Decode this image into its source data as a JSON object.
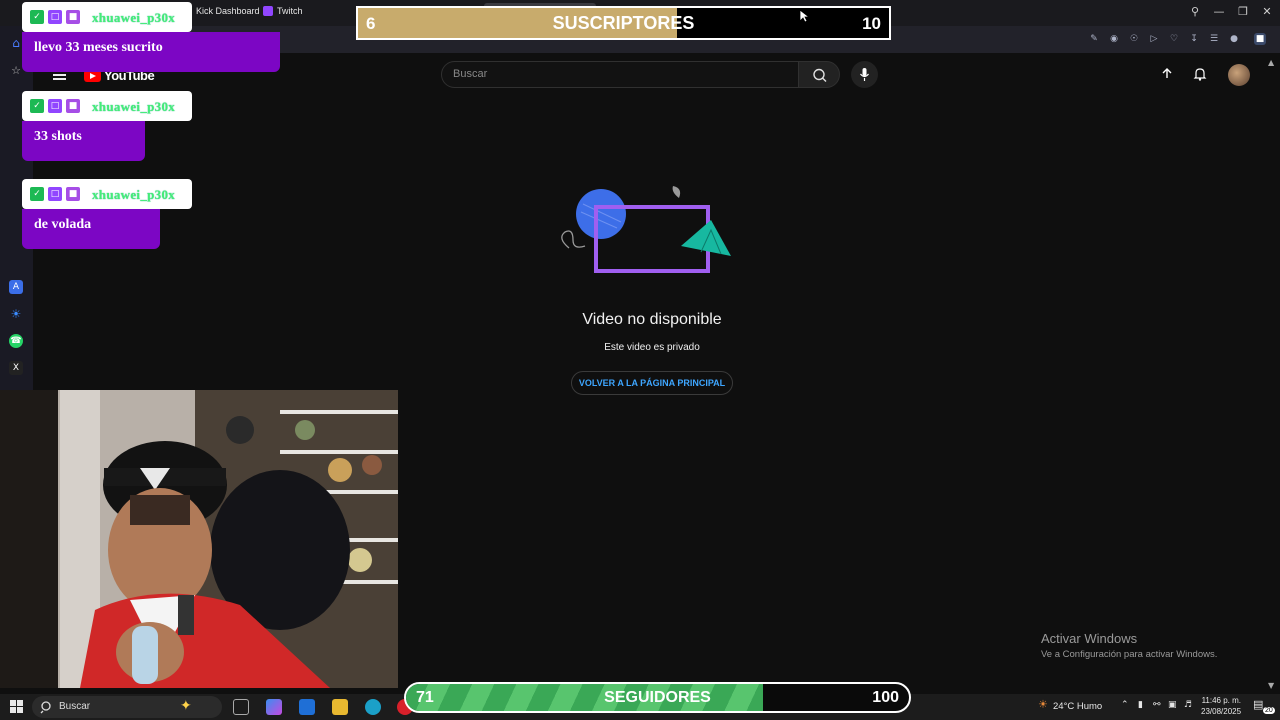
{
  "browser": {
    "bookmarks": [
      "Kick Dashboard",
      "Twitch"
    ]
  },
  "youtube": {
    "logo_text": "YouTube",
    "search_placeholder": "Buscar"
  },
  "content": {
    "title": "Video no disponible",
    "subtitle": "Este video es privado",
    "home_button": "VOLVER A LA PÁGINA PRINCIPAL"
  },
  "chat": [
    {
      "user": "xhuawei_p30x",
      "message": "llevo 33 meses sucrito"
    },
    {
      "user": "xhuawei_p30x",
      "message": "33 shots"
    },
    {
      "user": "xhuawei_p30x",
      "message": "de volada"
    }
  ],
  "goal_subs": {
    "current": "6",
    "label": "SUSCRIPTORES",
    "target": "10",
    "progress": 0.6,
    "color": "#c8ab6c"
  },
  "goal_followers": {
    "current": "71",
    "label": "SEGUIDORES",
    "target": "100",
    "progress": 0.71,
    "color": "#4cba63"
  },
  "watermark": {
    "line1": "Activar Windows",
    "line2": "Ve a Configuración para activar Windows."
  },
  "taskbar": {
    "search_label": "Buscar",
    "weather": "24°C  Humo",
    "time": "11:46 p. m.",
    "date": "23/08/2025",
    "notif_count": "20"
  }
}
